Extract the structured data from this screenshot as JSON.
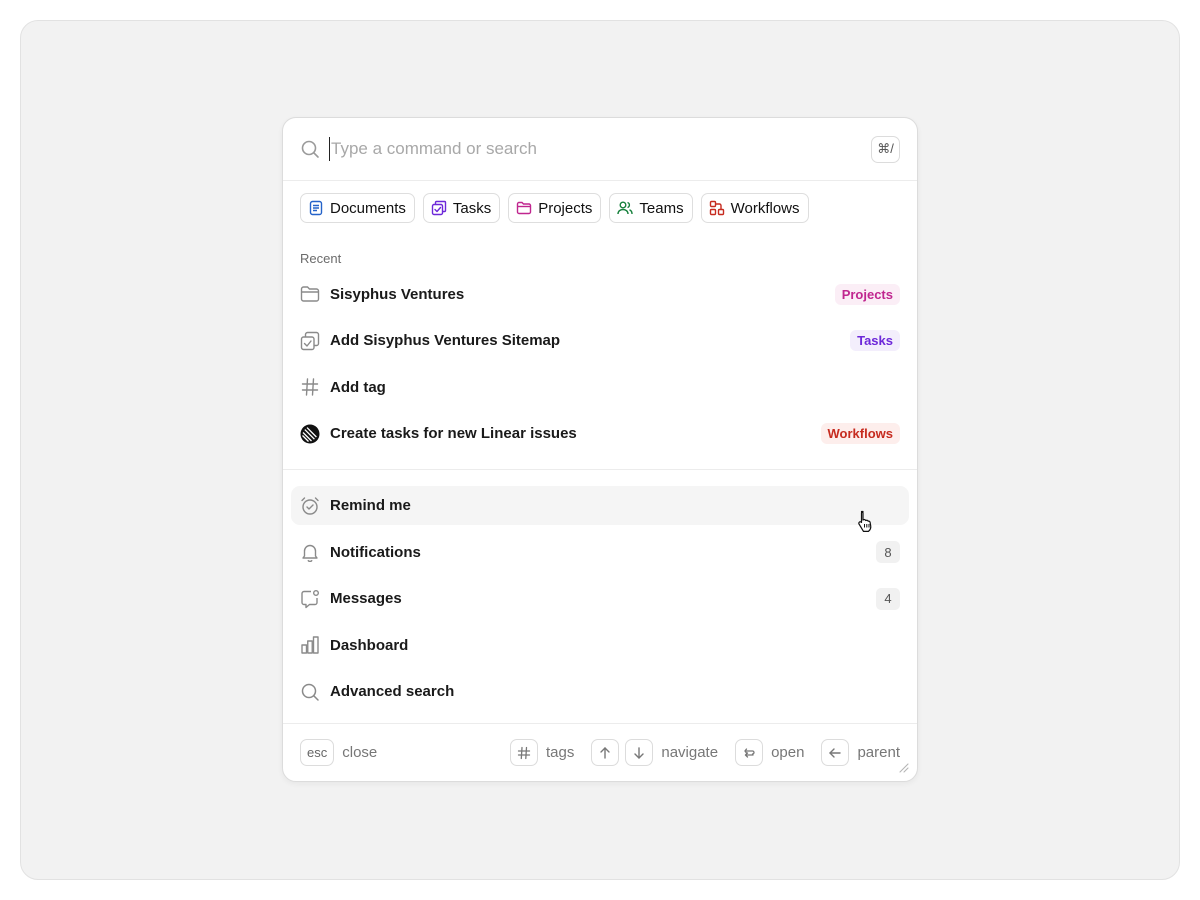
{
  "search": {
    "placeholder": "Type a command or search",
    "shortcut": "⌘/"
  },
  "filters": [
    {
      "label": "Documents",
      "icon": "document-icon",
      "color": "#2563c9"
    },
    {
      "label": "Tasks",
      "icon": "tasks-icon",
      "color": "#6d28d9"
    },
    {
      "label": "Projects",
      "icon": "folder-icon",
      "color": "#c0268f"
    },
    {
      "label": "Teams",
      "icon": "users-icon",
      "color": "#16803c"
    },
    {
      "label": "Workflows",
      "icon": "workflow-icon",
      "color": "#c62b1f"
    }
  ],
  "recent": {
    "label": "Recent",
    "items": [
      {
        "label": "Sisyphus Ventures",
        "icon": "folder-icon",
        "badge": "Projects",
        "badge_color": "#c0268f",
        "badge_bg": "#fbeef6"
      },
      {
        "label": "Add Sisyphus Ventures Sitemap",
        "icon": "tasks-icon",
        "badge": "Tasks",
        "badge_color": "#6d28d9",
        "badge_bg": "#f3eefc"
      },
      {
        "label": "Add tag",
        "icon": "hash-icon"
      },
      {
        "label": "Create tasks for new Linear issues",
        "icon": "linear-icon",
        "badge": "Workflows",
        "badge_color": "#c62b1f",
        "badge_bg": "#fdeeec"
      }
    ]
  },
  "actions": [
    {
      "label": "Remind me",
      "icon": "alarm-clock-icon"
    },
    {
      "label": "Notifications",
      "icon": "bell-icon",
      "count": "8"
    },
    {
      "label": "Messages",
      "icon": "message-icon",
      "count": "4"
    },
    {
      "label": "Dashboard",
      "icon": "bar-chart-icon"
    },
    {
      "label": "Advanced search",
      "icon": "search-icon"
    }
  ],
  "footer": {
    "esc_key": "esc",
    "close": "close",
    "tags": "tags",
    "navigate": "navigate",
    "open": "open",
    "parent": "parent"
  }
}
